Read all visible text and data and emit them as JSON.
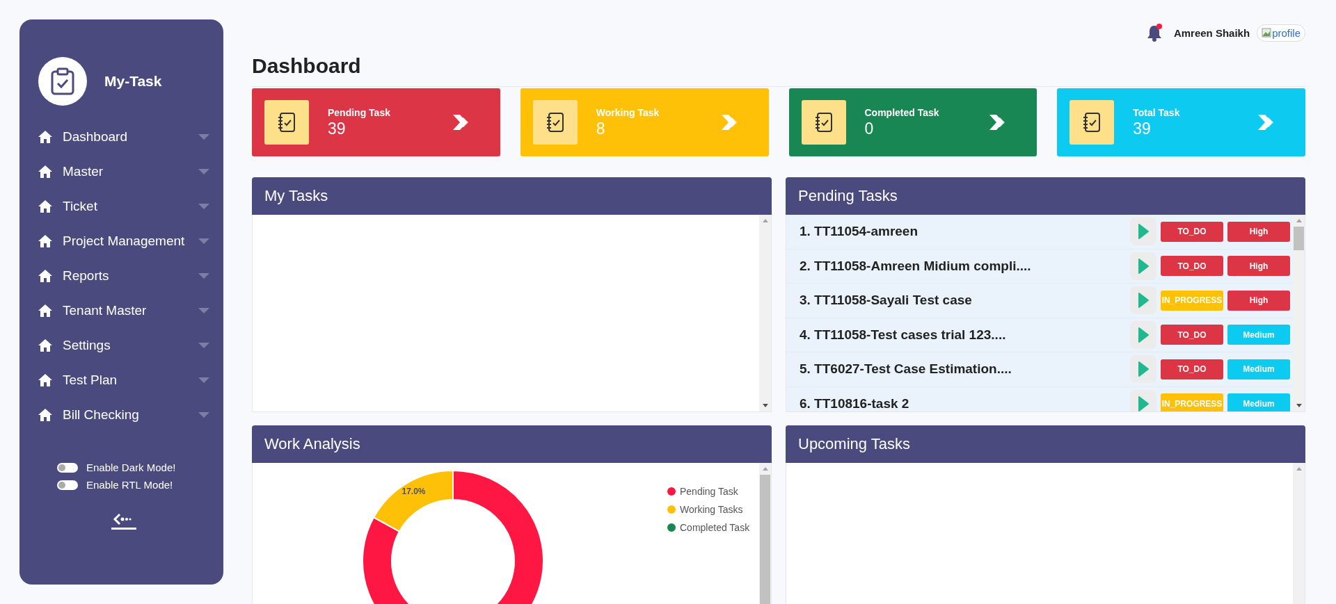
{
  "sidebar": {
    "brand": "My-Task",
    "items": [
      {
        "label": "Dashboard"
      },
      {
        "label": "Master"
      },
      {
        "label": "Ticket"
      },
      {
        "label": "Project Management"
      },
      {
        "label": "Reports"
      },
      {
        "label": "Tenant Master"
      },
      {
        "label": "Settings"
      },
      {
        "label": "Test Plan"
      },
      {
        "label": "Bill Checking"
      }
    ],
    "toggles": [
      {
        "label": "Enable Dark Mode!",
        "on": false
      },
      {
        "label": "Enable RTL Mode!",
        "on": false
      }
    ]
  },
  "header": {
    "notification_dot": true,
    "user_name": "Amreen Shaikh",
    "profile_alt": "profile"
  },
  "page_title": "Dashboard",
  "stat_cards": [
    {
      "label": "Pending Task",
      "value": "39",
      "color": "#dc3545"
    },
    {
      "label": "Working Task",
      "value": "8",
      "color": "#ffc107"
    },
    {
      "label": "Completed Task",
      "value": "0",
      "color": "#198754"
    },
    {
      "label": "Total Task",
      "value": "39",
      "color": "#0dcaf0"
    }
  ],
  "my_tasks": {
    "title": "My Tasks"
  },
  "pending_tasks": {
    "title": "Pending Tasks",
    "rows": [
      {
        "name": "1. TT11054-amreen",
        "status": {
          "label": "TO_DO",
          "color": "#dc3545"
        },
        "priority": {
          "label": "High",
          "color": "#dc3545"
        }
      },
      {
        "name": "2. TT11058-Amreen Midium compli....",
        "status": {
          "label": "TO_DO",
          "color": "#dc3545"
        },
        "priority": {
          "label": "High",
          "color": "#dc3545"
        }
      },
      {
        "name": "3. TT11058-Sayali Test case",
        "status": {
          "label": "IN_PROGRESS",
          "color": "#ffc107"
        },
        "priority": {
          "label": "High",
          "color": "#dc3545"
        }
      },
      {
        "name": "4. TT11058-Test cases trial 123....",
        "status": {
          "label": "TO_DO",
          "color": "#dc3545"
        },
        "priority": {
          "label": "Medium",
          "color": "#0dcaf0"
        }
      },
      {
        "name": "5. TT6027-Test Case Estimation....",
        "status": {
          "label": "TO_DO",
          "color": "#dc3545"
        },
        "priority": {
          "label": "Medium",
          "color": "#0dcaf0"
        }
      },
      {
        "name": "6. TT10816-task 2",
        "status": {
          "label": "IN_PROGRESS",
          "color": "#ffc107"
        },
        "priority": {
          "label": "Medium",
          "color": "#0dcaf0"
        }
      }
    ]
  },
  "work_analysis": {
    "title": "Work Analysis",
    "chart_data": {
      "type": "donut",
      "categories": [
        "Pending Task",
        "Working Tasks",
        "Completed Task"
      ],
      "series": [
        {
          "values": [
            83.0,
            17.0,
            0
          ]
        }
      ],
      "legend": "right",
      "colors": [
        "#ff1744",
        "#ffc107",
        "#198754"
      ],
      "value_labels": [
        null,
        "17.0%",
        null
      ]
    }
  },
  "upcoming_tasks": {
    "title": "Upcoming Tasks"
  }
}
